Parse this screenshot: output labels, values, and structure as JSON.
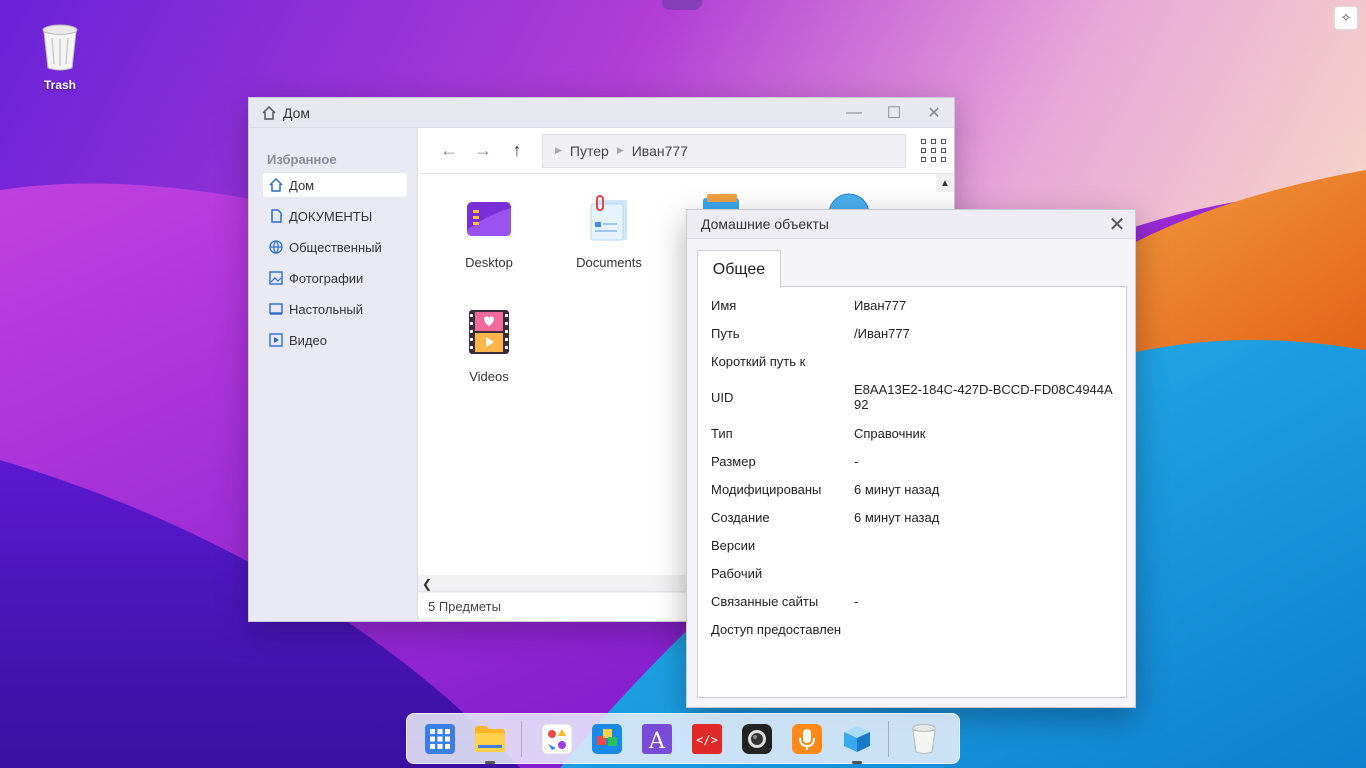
{
  "desktop": {
    "trash_label": "Trash"
  },
  "explorer": {
    "title": "Дом",
    "sidebar": {
      "heading": "Избранное",
      "items": [
        {
          "label": "Дом",
          "icon": "home-icon"
        },
        {
          "label": "ДОКУМЕНТЫ",
          "icon": "document-icon"
        },
        {
          "label": "Общественный",
          "icon": "globe-icon"
        },
        {
          "label": "Фотографии",
          "icon": "image-icon"
        },
        {
          "label": "Настольный",
          "icon": "monitor-icon"
        },
        {
          "label": "Видео",
          "icon": "video-icon"
        }
      ]
    },
    "breadcrumb": [
      "Путер",
      "Иван777"
    ],
    "files": [
      {
        "label": "Desktop"
      },
      {
        "label": "Documents"
      },
      {
        "label": "Videos"
      }
    ],
    "status": "5 Предметы"
  },
  "properties": {
    "title": "Домашние объекты",
    "tab": "Общее",
    "rows": [
      {
        "key": "Имя",
        "value": "Иван777"
      },
      {
        "key": "Путь",
        "value": "/Иван777"
      },
      {
        "key": "Короткий путь к",
        "value": ""
      },
      {
        "key": "UID",
        "value": "E8AA13E2-184C-427D-BCCD-FD08C4944A92"
      },
      {
        "key": "Тип",
        "value": "Справочник"
      },
      {
        "key": "Размер",
        "value": "-"
      },
      {
        "key": "Модифицированы",
        "value": "6 минут назад"
      },
      {
        "key": "Создание",
        "value": "6 минут назад"
      },
      {
        "key": "Версии",
        "value": ""
      },
      {
        "key": "Рабочий",
        "value": ""
      },
      {
        "key": "Связанные сайты",
        "value": "-"
      },
      {
        "key": "Доступ предоставлен",
        "value": ""
      }
    ]
  },
  "dock": {
    "items": [
      "app-launcher-icon",
      "file-manager-icon",
      "app-center-icon",
      "blocks-icon",
      "font-editor-icon",
      "code-editor-icon",
      "camera-icon",
      "voice-recorder-icon",
      "3d-cube-icon",
      "trash-icon"
    ]
  },
  "colors": {
    "accent": "#2a6dc9",
    "wallpaper_purple": "#7b2fe0",
    "wallpaper_orange": "#f07a1a",
    "wallpaper_blue": "#1a9fe0"
  }
}
